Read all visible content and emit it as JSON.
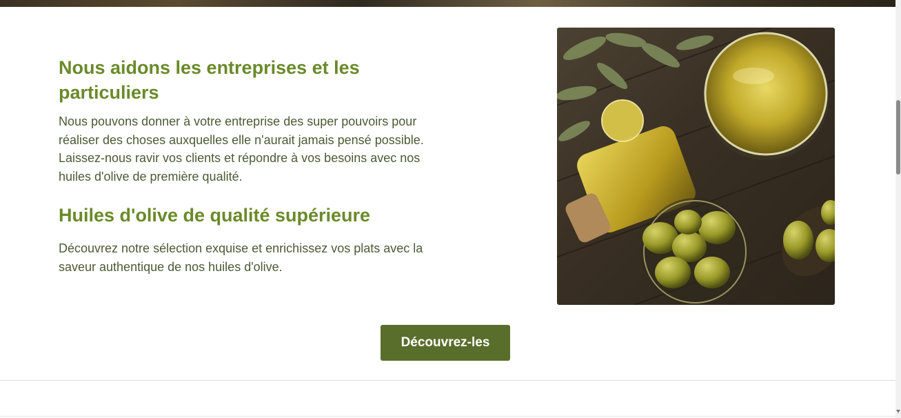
{
  "section": {
    "heading_1": "Nous aidons les entreprises et les particuliers",
    "paragraph_1": "Nous pouvons donner à votre entreprise des super pouvoirs pour réaliser des choses auxquelles elle n'aurait jamais pensé possible. Laissez-nous ravir vos clients et répondre à vos besoins avec nos huiles d'olive de première qualité.",
    "heading_2": "Huiles d'olive de qualité supérieure",
    "paragraph_2": "Découvrez notre sélection exquise et enrichissez vos plats avec la saveur authentique de nos huiles d'olive."
  },
  "image": {
    "icon": "olive-oil-photo",
    "alt": "Huile d'olive et olives"
  },
  "cta": {
    "label": "Découvrez-les"
  },
  "colors": {
    "heading": "#6a8a2a",
    "text": "#4b5a34",
    "button": "#5a6e2c"
  }
}
